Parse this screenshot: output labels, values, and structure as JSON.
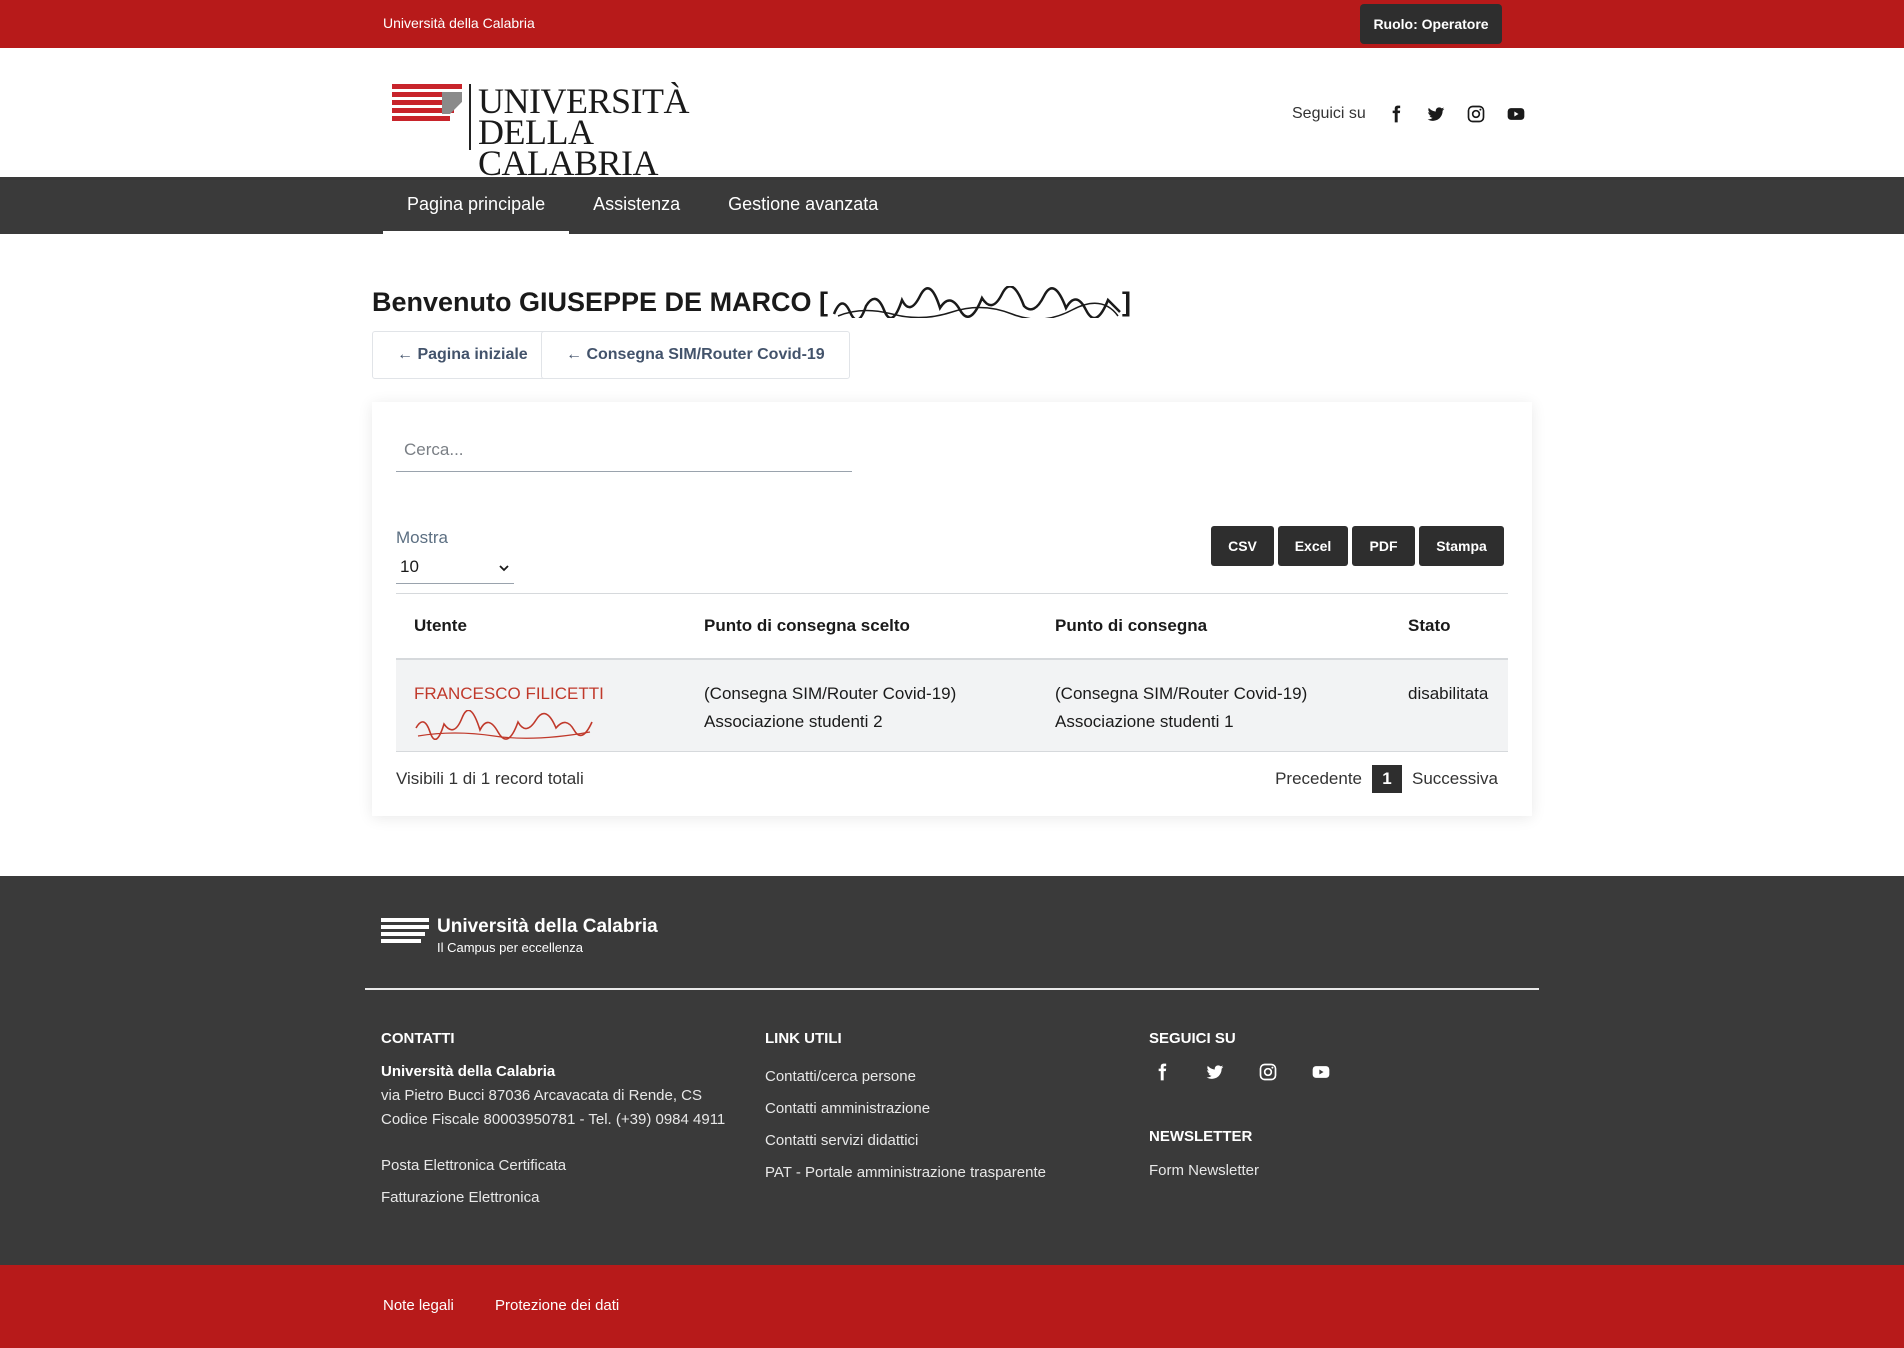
{
  "topbar": {
    "university": "Università della Calabria",
    "role": "Ruolo: Operatore"
  },
  "header": {
    "logo_line1": "UNIVERSITÀ",
    "logo_line2": "DELLA CALABRIA",
    "follow_label": "Seguici su",
    "social_icons": [
      "facebook-icon",
      "twitter-icon",
      "instagram-icon",
      "youtube-icon"
    ]
  },
  "nav": {
    "items": [
      "Pagina principale",
      "Assistenza",
      "Gestione avanzata"
    ],
    "active": "Pagina principale"
  },
  "main": {
    "welcome": "Benvenuto GIUSEPPE DE MARCO [",
    "welcome_close": "]",
    "back_buttons": [
      "← Pagina iniziale",
      "← Consegna SIM/Router Covid-19"
    ],
    "search_placeholder": "Cerca...",
    "show_label": "Mostra",
    "show_value": "10",
    "export_buttons": [
      "CSV",
      "Excel",
      "PDF",
      "Stampa"
    ],
    "table": {
      "headers": [
        "Utente",
        "Punto di consegna scelto",
        "Punto di consegna",
        "Stato"
      ],
      "rows": [
        {
          "user": "FRANCESCO FILICETTI",
          "chosen_line1": "(Consegna SIM/Router Covid-19)",
          "chosen_line2": "Associazione studenti 2",
          "point_line1": "(Consegna SIM/Router Covid-19)",
          "point_line2": "Associazione studenti 1",
          "status": "disabilitata"
        }
      ]
    },
    "records_info": "Visibili 1 di 1 record totali",
    "pager": {
      "prev": "Precedente",
      "current": "1",
      "next": "Successiva"
    }
  },
  "footer": {
    "brand": "Università della Calabria",
    "tagline": "Il Campus per eccellenza",
    "contacts": {
      "title": "CONTATTI",
      "name": "Università della Calabria",
      "address": "via Pietro Bucci 87036 Arcavacata di Rende, CS",
      "fiscal": "Codice Fiscale 80003950781 - Tel. (+39) 0984 4911",
      "links": [
        "Posta Elettronica Certificata",
        "Fatturazione Elettronica"
      ]
    },
    "useful_links": {
      "title": "LINK UTILI",
      "links": [
        "Contatti/cerca persone",
        "Contatti amministrazione",
        "Contatti servizi didattici",
        "PAT - Portale amministrazione trasparente"
      ]
    },
    "follow": {
      "title": "SEGUICI SU"
    },
    "newsletter": {
      "title": "NEWSLETTER",
      "link": "Form Newsletter"
    }
  },
  "bottombar": {
    "links": [
      "Note legali",
      "Protezione dei dati"
    ]
  },
  "colors": {
    "brand_red": "#b71a1a",
    "dark": "#3a3a3a",
    "button_dark": "#2e2e2e",
    "link_red": "#c0392b"
  }
}
